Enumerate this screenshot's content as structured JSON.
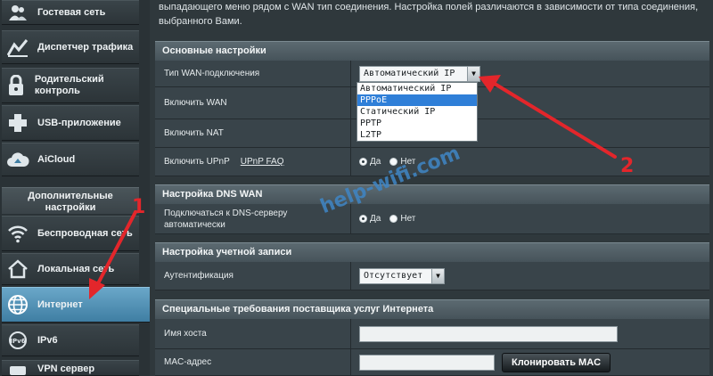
{
  "sidebar": {
    "items": [
      {
        "label": "Гостевая сеть",
        "icon": "guest-network-icon"
      },
      {
        "label": "Диспетчер трафика",
        "icon": "traffic-manager-icon"
      },
      {
        "label": "Родительский контроль",
        "icon": "parental-control-icon"
      },
      {
        "label": "USB-приложение",
        "icon": "usb-app-icon"
      },
      {
        "label": "AiCloud",
        "icon": "cloud-icon"
      }
    ],
    "section_title": "Дополнительные настройки",
    "advanced": [
      {
        "label": "Беспроводная сеть",
        "icon": "wifi-icon"
      },
      {
        "label": "Локальная сеть",
        "icon": "home-icon"
      },
      {
        "label": "Интернет",
        "icon": "globe-icon",
        "active": true
      },
      {
        "label": "IPv6",
        "icon": "ipv6-icon"
      },
      {
        "label": "VPN сервер",
        "icon": "vpn-icon"
      }
    ]
  },
  "main": {
    "intro": "выпадающего меню рядом с WAN тип соединения. Настройка полей различаются в зависимости от типа соединения, выбранного Вами.",
    "basic": {
      "title": "Основные настройки",
      "wan_type_label": "Тип WAN-подключения",
      "wan_type_value": "Автоматический IP",
      "wan_type_options": [
        "Автоматический IP",
        "PPPoE",
        "Статический IP",
        "PPTP",
        "L2TP"
      ],
      "wan_type_highlighted": "PPPoE",
      "enable_wan_label": "Включить WAN",
      "enable_nat_label": "Включить NAT",
      "enable_upnp_label": "Включить UPnP",
      "upnp_faq": "UPnP FAQ",
      "yes": "Да",
      "no": "Нет"
    },
    "dns": {
      "title": "Настройка DNS WAN",
      "auto_dns_label": "Подключаться к DNS-серверу автоматически",
      "yes": "Да",
      "no": "Нет"
    },
    "account": {
      "title": "Настройка учетной записи",
      "auth_label": "Аутентификация",
      "auth_value": "Отсутствует"
    },
    "isp": {
      "title": "Специальные требования поставщика услуг Интернета",
      "hostname_label": "Имя хоста",
      "hostname_value": "",
      "mac_label": "MAC-адрес",
      "mac_value": "",
      "clone_mac_button": "Клонировать MAC"
    }
  },
  "watermark": "help-wifi.com",
  "annotations": {
    "one": "1",
    "two": "2"
  },
  "colors": {
    "accent_active": "#4f8db1",
    "annotation_red": "#e3262b",
    "dropdown_highlight": "#2f7fd8"
  }
}
